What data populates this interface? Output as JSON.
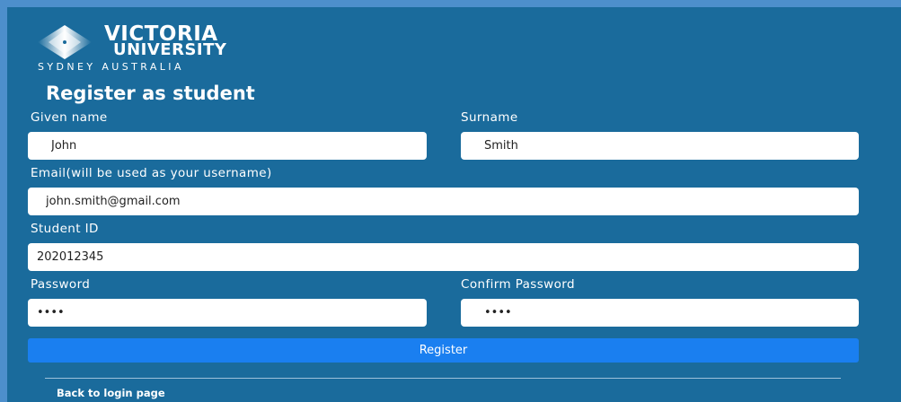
{
  "brand": {
    "line1": "VICTORIA",
    "line2": "UNIVERSITY",
    "line3": "SYDNEY AUSTRALIA",
    "icon": "diamond-logo-icon"
  },
  "form": {
    "title": "Register as student",
    "given_name": {
      "label": "Given name",
      "value": "John"
    },
    "surname": {
      "label": "Surname",
      "value": "Smith"
    },
    "email": {
      "label": "Email(will be used as your username)",
      "value": "john.smith@gmail.com"
    },
    "student_id": {
      "label": "Student ID",
      "value": "202012345"
    },
    "password": {
      "label": "Password",
      "value": "1234"
    },
    "confirm_password": {
      "label": "Confirm Password",
      "value": "1234"
    },
    "submit_label": "Register",
    "back_link": "Back to login page"
  },
  "colors": {
    "page_background": "#4d8fcc",
    "panel_background": "#1a6b9c",
    "button": "#1a7ff0",
    "text": "#ffffff"
  }
}
